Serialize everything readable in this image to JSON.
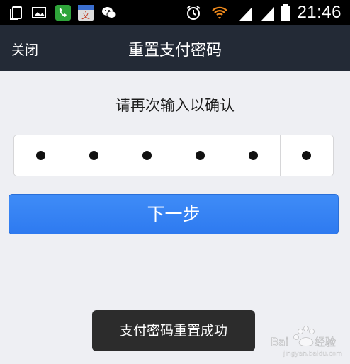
{
  "status_bar": {
    "time": "21:46",
    "icons": [
      "copy-icon",
      "gallery-icon",
      "phone-icon",
      "translate-icon",
      "wechat-icon",
      "alarm-icon",
      "wifi-icon",
      "signal-icon",
      "signal-icon",
      "battery-icon"
    ]
  },
  "nav": {
    "close_label": "关闭",
    "title": "重置支付密码"
  },
  "prompt": "请再次输入以确认",
  "pin": {
    "length": 6,
    "filled": 6
  },
  "next_button": {
    "label": "下一步"
  },
  "toast": {
    "message": "支付密码重置成功"
  },
  "watermark": {
    "brand": "Baidu经验",
    "text": "jingyan.baidu.com"
  },
  "colors": {
    "nav_bg": "#232a36",
    "button_blue": "#3583f4",
    "page_bg": "#eeeff3",
    "toast_bg": "#2c2c2c"
  }
}
